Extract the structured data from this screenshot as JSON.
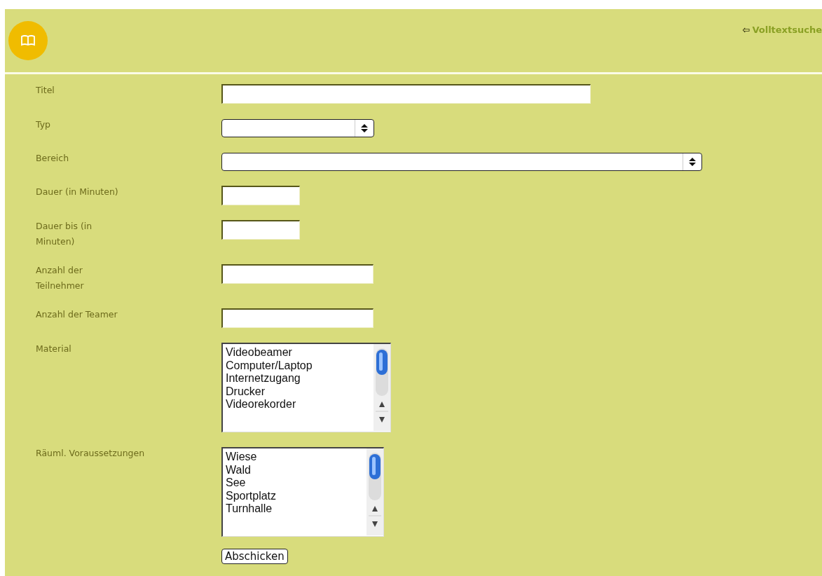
{
  "header": {
    "link": {
      "icon": "⇦",
      "label": "Volltextsuche"
    }
  },
  "form": {
    "fields": [
      {
        "label": "Titel",
        "kind": "text"
      },
      {
        "label": "Typ",
        "kind": "select"
      },
      {
        "label": "Bereich",
        "kind": "select"
      },
      {
        "label": "Dauer (in Minuten)",
        "kind": "text"
      },
      {
        "label": "Dauer bis (in Minuten)",
        "kind": "text"
      },
      {
        "label": "Anzahl der Teilnehmer",
        "kind": "text"
      },
      {
        "label": "Anzahl der Teamer",
        "kind": "text"
      },
      {
        "label": "Material",
        "kind": "listbox",
        "options": [
          "Videobeamer",
          "Computer/Laptop",
          "Internetzugang",
          "Drucker",
          "Videorekorder"
        ]
      },
      {
        "label": "Räuml. Voraussetzungen",
        "kind": "listbox",
        "options": [
          "Wiese",
          "Wald",
          "See",
          "Sportplatz",
          "Turnhalle"
        ]
      }
    ],
    "submit": "Abschicken"
  }
}
